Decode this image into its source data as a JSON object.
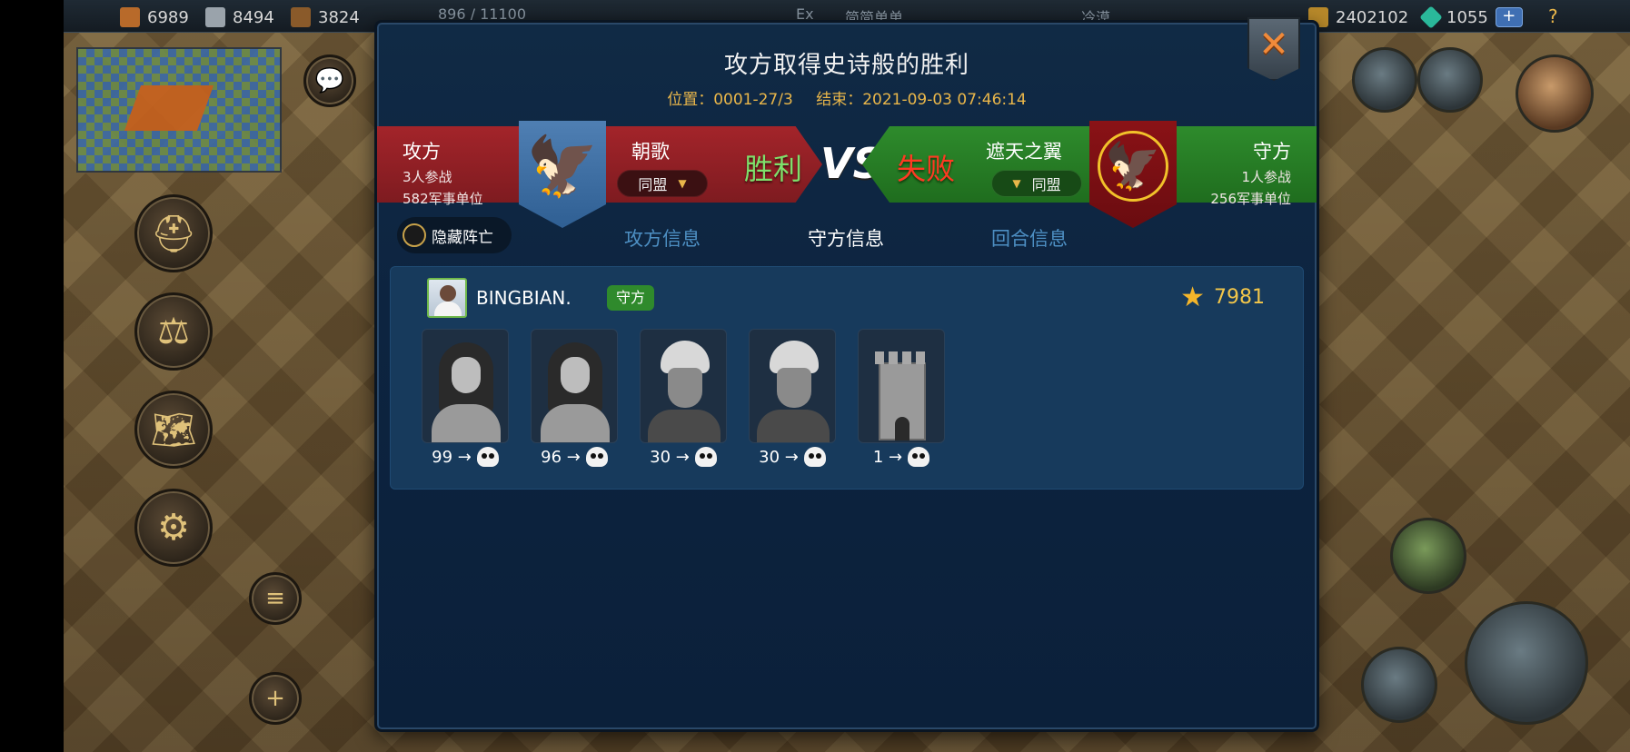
{
  "topbar": {
    "res_brick": "6989",
    "res_stone": "8494",
    "res_wood": "3824",
    "res_gold": "2402102",
    "res_gems": "1055",
    "help": "?",
    "faded_1": "896 / 11100",
    "faded_2": "Ex",
    "faded_3": "简简单单",
    "faded_4": "冷漠"
  },
  "dialog": {
    "title": "攻方取得史诗般的胜利",
    "location": "位置：0001-27/3",
    "end_time": "结束：2021-09-03 07:46:14",
    "close_symbol": "✕"
  },
  "attacker": {
    "label": "攻方",
    "participants": "3人参战",
    "units": "582军事单位",
    "alliance": "朝歌",
    "relation": "同盟",
    "result": "胜利",
    "color": "#a3242a"
  },
  "vs": "VS",
  "defender": {
    "label": "守方",
    "participants": "1人参战",
    "units": "256军事单位",
    "alliance": "遮天之翼",
    "relation": "同盟",
    "result": "失败",
    "color": "#2e8b2c"
  },
  "tabs": {
    "hide_dead": "隐藏阵亡",
    "attack_info": "攻方信息",
    "defense_info": "守方信息",
    "round_info": "回合信息",
    "active": "defense_info"
  },
  "participant": {
    "name": "BINGBIAN.",
    "role": "守方",
    "score": "7981",
    "units": [
      {
        "type": "woman",
        "count": "99 →"
      },
      {
        "type": "woman",
        "count": "96 →"
      },
      {
        "type": "man",
        "count": "30 →"
      },
      {
        "type": "man",
        "count": "30 →"
      },
      {
        "type": "tower",
        "count": "1 →"
      }
    ]
  }
}
